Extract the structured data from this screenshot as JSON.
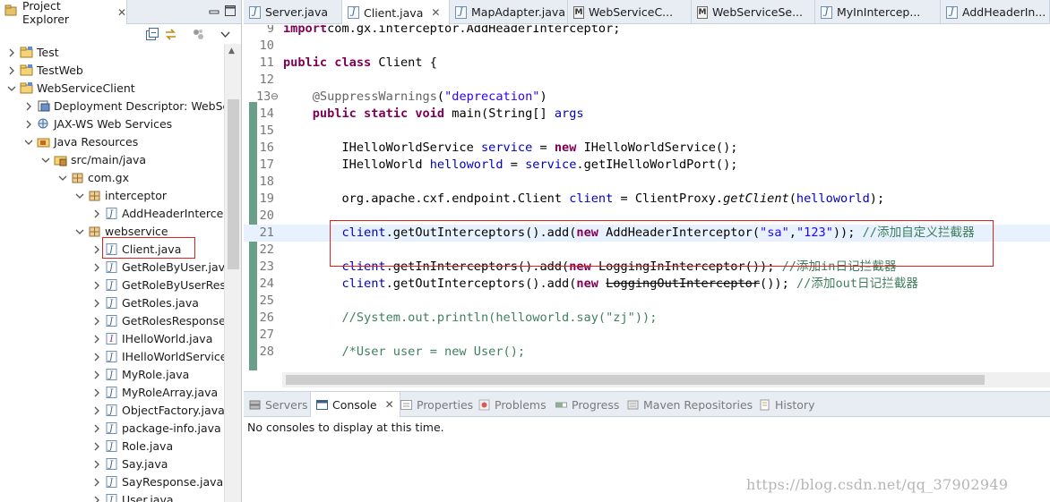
{
  "explorer": {
    "tab_title": "Project Explorer",
    "tab_close": "✕",
    "tree": [
      {
        "label": "Test",
        "icon": "project-folder-icon",
        "level": 0,
        "expanded": false
      },
      {
        "label": "TestWeb",
        "icon": "project-folder-icon",
        "level": 0,
        "expanded": false
      },
      {
        "label": "WebServiceClient",
        "icon": "project-folder-icon",
        "level": 0,
        "expanded": true
      },
      {
        "label": "Deployment Descriptor: WebSer",
        "icon": "deployment-descriptor-icon",
        "level": 1,
        "expanded": false
      },
      {
        "label": "JAX-WS Web Services",
        "icon": "web-services-icon",
        "level": 1,
        "expanded": false
      },
      {
        "label": "Java Resources",
        "icon": "java-resources-icon",
        "level": 1,
        "expanded": true
      },
      {
        "label": "src/main/java",
        "icon": "source-folder-icon",
        "level": 2,
        "expanded": true
      },
      {
        "label": "com.gx",
        "icon": "package-icon",
        "level": 3,
        "expanded": true
      },
      {
        "label": "interceptor",
        "icon": "package-icon",
        "level": 4,
        "expanded": true
      },
      {
        "label": "AddHeaderIntercep",
        "icon": "java-file-icon",
        "level": 5,
        "expanded": false
      },
      {
        "label": "webservice",
        "icon": "package-icon",
        "level": 4,
        "expanded": true
      },
      {
        "label": "Client.java",
        "icon": "java-file-icon",
        "level": 5,
        "expanded": false,
        "selected": true
      },
      {
        "label": "GetRoleByUser.java",
        "icon": "java-file-icon",
        "level": 5,
        "expanded": false
      },
      {
        "label": "GetRoleByUserRes",
        "icon": "java-file-icon",
        "level": 5,
        "expanded": false
      },
      {
        "label": "GetRoles.java",
        "icon": "java-file-icon",
        "level": 5,
        "expanded": false
      },
      {
        "label": "GetRolesResponse",
        "icon": "java-file-icon",
        "level": 5,
        "expanded": false
      },
      {
        "label": "IHelloWorld.java",
        "icon": "java-interface-icon",
        "level": 5,
        "expanded": false
      },
      {
        "label": "IHelloWorldService",
        "icon": "java-file-icon",
        "level": 5,
        "expanded": false
      },
      {
        "label": "MyRole.java",
        "icon": "java-file-icon",
        "level": 5,
        "expanded": false
      },
      {
        "label": "MyRoleArray.java",
        "icon": "java-file-icon",
        "level": 5,
        "expanded": false
      },
      {
        "label": "ObjectFactory.java",
        "icon": "java-file-icon",
        "level": 5,
        "expanded": false
      },
      {
        "label": "package-info.java",
        "icon": "java-file-icon",
        "level": 5,
        "expanded": false
      },
      {
        "label": "Role.java",
        "icon": "java-file-icon",
        "level": 5,
        "expanded": false
      },
      {
        "label": "Say.java",
        "icon": "java-file-icon",
        "level": 5,
        "expanded": false
      },
      {
        "label": "SayResponse.java",
        "icon": "java-file-icon",
        "level": 5,
        "expanded": false
      },
      {
        "label": "User.java",
        "icon": "java-file-icon",
        "level": 5,
        "expanded": false
      }
    ]
  },
  "editor_tabs": [
    {
      "label": "Server.java",
      "icon": "java-file-icon",
      "active": false
    },
    {
      "label": "Client.java",
      "icon": "java-file-icon",
      "active": true
    },
    {
      "label": "MapAdapter.java",
      "icon": "java-file-icon",
      "active": false
    },
    {
      "label": "WebServiceC...",
      "icon": "class-file-icon",
      "active": false
    },
    {
      "label": "WebServiceSe...",
      "icon": "class-file-icon",
      "active": false
    },
    {
      "label": "MyInIntercep...",
      "icon": "java-file-icon",
      "active": false
    },
    {
      "label": "AddHeaderIn...",
      "icon": "java-file-icon",
      "active": false
    }
  ],
  "code": [
    {
      "n": "9",
      "tokens": [
        [
          "kw",
          "import"
        ],
        [
          "",
          "com.gx.interceptor.AddHeaderInterceptor;"
        ]
      ]
    },
    {
      "n": "10",
      "tokens": []
    },
    {
      "n": "11",
      "tokens": [
        [
          "kw",
          "public"
        ],
        [
          "",
          " "
        ],
        [
          "kw",
          "class"
        ],
        [
          "",
          " Client {"
        ]
      ]
    },
    {
      "n": "12",
      "tokens": []
    },
    {
      "n": "13⊖",
      "tokens": [
        [
          "",
          "    "
        ],
        [
          "ann",
          "@SuppressWarnings"
        ],
        [
          "",
          "("
        ],
        [
          "str",
          "\"deprecation\""
        ],
        [
          "",
          ")"
        ]
      ]
    },
    {
      "n": "14",
      "tokens": [
        [
          "",
          "    "
        ],
        [
          "kw",
          "public"
        ],
        [
          "",
          " "
        ],
        [
          "kw",
          "static"
        ],
        [
          "",
          " "
        ],
        [
          "kw",
          "void"
        ],
        [
          "",
          " main(String[] "
        ],
        [
          "var",
          "args"
        ],
        [
          ") {"
        ]
      ]
    },
    {
      "n": "15",
      "tokens": []
    },
    {
      "n": "16",
      "tokens": [
        [
          "",
          "        IHelloWorldService "
        ],
        [
          "var",
          "service"
        ],
        [
          "",
          " = "
        ],
        [
          "kw",
          "new"
        ],
        [
          "",
          " IHelloWorldService();"
        ]
      ]
    },
    {
      "n": "17",
      "tokens": [
        [
          "",
          "        IHelloWorld "
        ],
        [
          "var",
          "helloworld"
        ],
        [
          "",
          " = "
        ],
        [
          "var",
          "service"
        ],
        [
          "",
          ".getIHelloWorldPort();"
        ]
      ]
    },
    {
      "n": "18",
      "tokens": []
    },
    {
      "n": "19",
      "tokens": [
        [
          "",
          "        org.apache.cxf.endpoint.Client "
        ],
        [
          "var",
          "client"
        ],
        [
          "",
          " = ClientProxy."
        ],
        [
          "it",
          "getClient"
        ],
        [
          "",
          "("
        ],
        [
          "var",
          "helloworld"
        ],
        [
          "",
          ");"
        ]
      ]
    },
    {
      "n": "20",
      "tokens": []
    },
    {
      "n": "21",
      "tokens": [
        [
          "",
          "        "
        ],
        [
          "var",
          "client"
        ],
        [
          "",
          ".getOutInterceptors().add("
        ],
        [
          "kw",
          "new"
        ],
        [
          "",
          " AddHeaderInterceptor("
        ],
        [
          "str",
          "\"sa\""
        ],
        [
          "",
          ","
        ],
        [
          "str",
          "\"123\""
        ],
        [
          "",
          "));"
        ],
        [
          "",
          " "
        ],
        [
          "cm",
          "//添加自定义拦截器"
        ]
      ]
    },
    {
      "n": "22",
      "tokens": []
    },
    {
      "n": "23",
      "tokens": [
        [
          "",
          "        "
        ],
        [
          "var",
          "client"
        ],
        [
          "",
          ".getInInterceptors().add("
        ],
        [
          "kw",
          "new"
        ],
        [
          "",
          " "
        ],
        [
          "strike",
          "LoggingInInterceptor"
        ],
        [
          "",
          "()); "
        ],
        [
          "cm",
          "//添加in日记拦截器"
        ]
      ]
    },
    {
      "n": "24",
      "tokens": [
        [
          "",
          "        "
        ],
        [
          "var",
          "client"
        ],
        [
          "",
          ".getOutInterceptors().add("
        ],
        [
          "kw",
          "new"
        ],
        [
          "",
          " "
        ],
        [
          "strike",
          "LoggingOutInterceptor"
        ],
        [
          "",
          "()); "
        ],
        [
          "cm",
          "//添加out日记拦截器"
        ]
      ]
    },
    {
      "n": "25",
      "tokens": []
    },
    {
      "n": "26",
      "tokens": [
        [
          "",
          "        "
        ],
        [
          "cm",
          "//System.out.println(helloworld.say(\"zj\"));"
        ]
      ]
    },
    {
      "n": "27",
      "tokens": []
    },
    {
      "n": "28",
      "tokens": [
        [
          "",
          "        "
        ],
        [
          "cm",
          "/*User user = new User();"
        ]
      ]
    }
  ],
  "console": {
    "tabs": [
      {
        "label": "Servers",
        "icon": "servers-icon",
        "active": false
      },
      {
        "label": "Console",
        "icon": "console-icon",
        "active": true
      },
      {
        "label": "Properties",
        "icon": "properties-icon",
        "active": false
      },
      {
        "label": "Problems",
        "icon": "problems-icon",
        "active": false
      },
      {
        "label": "Progress",
        "icon": "progress-icon",
        "active": false
      },
      {
        "label": "Maven Repositories",
        "icon": "maven-icon",
        "active": false
      },
      {
        "label": "History",
        "icon": "history-icon",
        "active": false
      }
    ],
    "message": "No consoles to display at this time."
  },
  "watermark": "https://blog.csdn.net/qq_37902949",
  "colors": {
    "keyword": "#7f0055",
    "string": "#2a00ff",
    "comment": "#3f7f5f",
    "field": "#0000c0",
    "highlight_box": "#e0211e",
    "selection": "#d4e6f9"
  }
}
